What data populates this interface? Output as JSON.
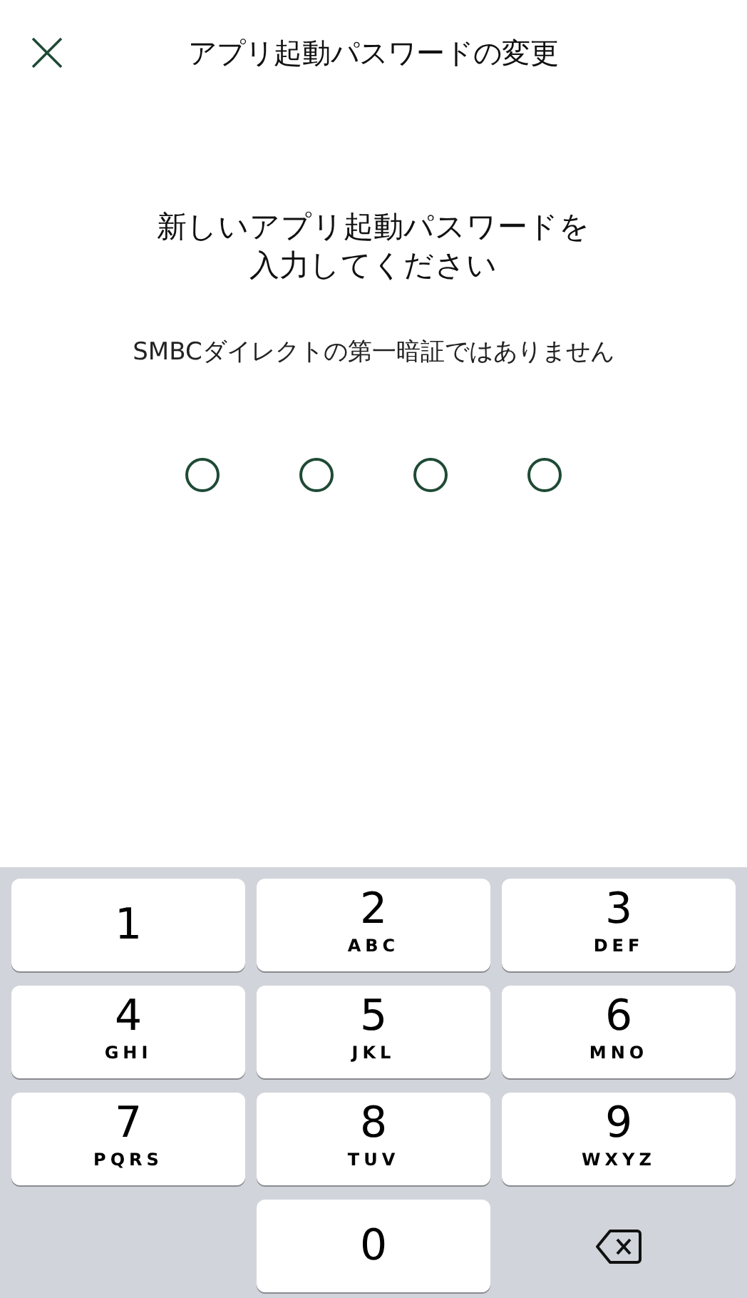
{
  "header": {
    "title": "アプリ起動パスワードの変更"
  },
  "prompt": {
    "lines": [
      "新しいアプリ起動パスワードを",
      "入力してください"
    ]
  },
  "note": "SMBCダイレクトの第一暗証ではありません",
  "pin_dots": [
    {
      "filled": false
    },
    {
      "filled": false
    },
    {
      "filled": false
    },
    {
      "filled": false
    }
  ],
  "keypad": [
    {
      "kind": "digit",
      "digit": "1"
    },
    {
      "kind": "digit",
      "digit": "2",
      "letters": "ABC"
    },
    {
      "kind": "digit",
      "digit": "3",
      "letters": "DEF"
    },
    {
      "kind": "digit",
      "digit": "4",
      "letters": "GHI"
    },
    {
      "kind": "digit",
      "digit": "5",
      "letters": "JKL"
    },
    {
      "kind": "digit",
      "digit": "6",
      "letters": "MNO"
    },
    {
      "kind": "digit",
      "digit": "7",
      "letters": "PQRS"
    },
    {
      "kind": "digit",
      "digit": "8",
      "letters": "TUV"
    },
    {
      "kind": "digit",
      "digit": "9",
      "letters": "WXYZ"
    },
    {
      "kind": "blank"
    },
    {
      "kind": "digit",
      "digit": "0"
    },
    {
      "kind": "delete"
    }
  ]
}
